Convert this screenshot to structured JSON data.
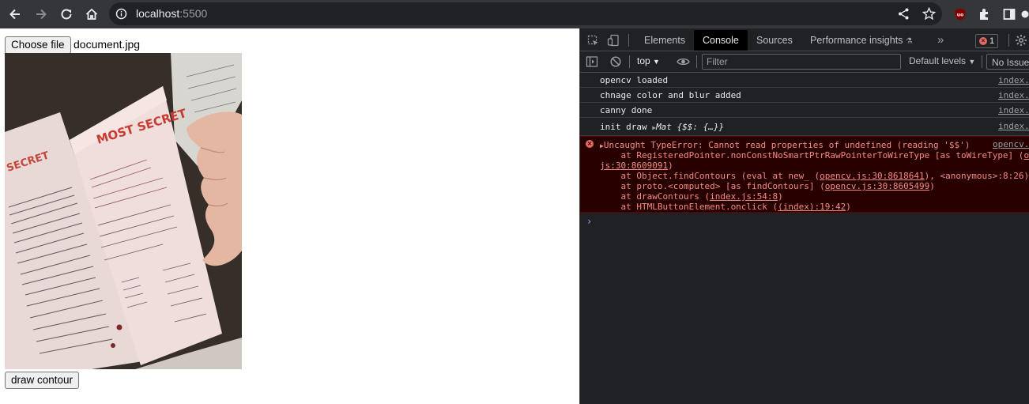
{
  "browser": {
    "url_host": "localhost",
    "url_port": ":5500"
  },
  "page": {
    "choose_file_label": "Choose file",
    "file_name": "document.jpg",
    "image_alt": "document with MOST SECRET header",
    "draw_button_label": "draw contour"
  },
  "devtools": {
    "tabs": [
      {
        "label": "Elements"
      },
      {
        "label": "Console"
      },
      {
        "label": "Sources"
      },
      {
        "label": "Performance insights"
      }
    ],
    "error_count": "1",
    "context": "top",
    "filter_placeholder": "Filter",
    "levels": "Default levels",
    "issues": "No Issues",
    "logs": [
      {
        "text": "opencv loaded",
        "source": "index.js"
      },
      {
        "text": "chnage color and blur added",
        "source": "index.js"
      },
      {
        "text": "canny done",
        "source": "index.js"
      },
      {
        "text_prefix": "init draw ",
        "mat": "Mat {$$: {…}}",
        "source": "index.js"
      }
    ],
    "error": {
      "message": "Uncaught TypeError: Cannot read properties of undefined (reading '$$')",
      "source": "opencv.js",
      "stack": [
        {
          "prefix": "    at RegisteredPointer.nonConstNoSmartPtrRawPointerToWireType [as toWireType] (",
          "link": "o",
          "suffix": ""
        },
        {
          "prefix": "",
          "link": "js:30:8609091",
          "suffix": ")"
        },
        {
          "prefix": "    at Object.findContours (eval at new_ (",
          "link": "opencv.js:30:8618641",
          "suffix": "), <anonymous>:8:26)"
        },
        {
          "prefix": "    at proto.<computed> [as findContours] (",
          "link": "opencv.js:30:8605499",
          "suffix": ")"
        },
        {
          "prefix": "    at drawContours (",
          "link": "index.js:54:8",
          "suffix": ")"
        },
        {
          "prefix": "    at HTMLButtonElement.onclick (",
          "link": "(index):19:42",
          "suffix": ")"
        }
      ]
    },
    "prompt_glyph": "›"
  }
}
